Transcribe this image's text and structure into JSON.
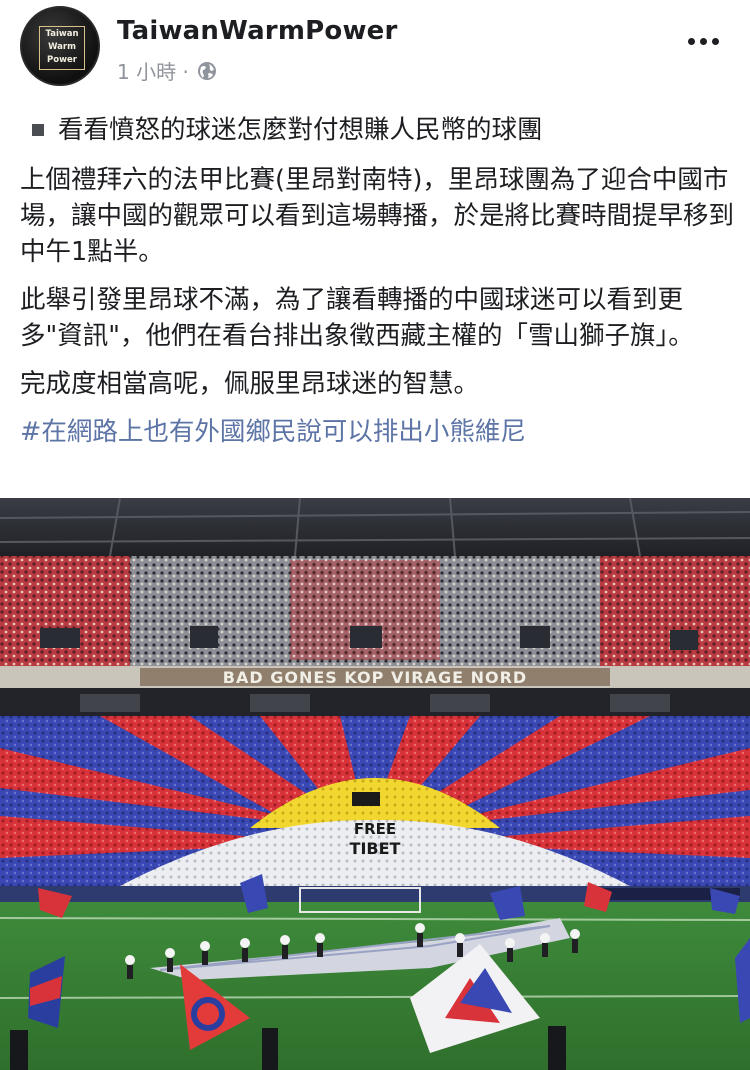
{
  "post": {
    "author": "TaiwanWarmPower",
    "avatar_text": [
      "Taiwan",
      "Warm",
      "Power"
    ],
    "time": "1 小時 ·",
    "audience_icon": "globe-icon",
    "menu_icon": "more-horizontal-icon",
    "headline": "看看憤怒的球迷怎麼對付想賺人民幣的球團",
    "paragraphs": [
      "上個禮拜六的法甲比賽(里昂對南特)，里昂球團為了迎合中國市場，讓中國的觀眾可以看到這場轉播，於是將比賽時間提早移到中午1點半。",
      "此舉引發里昂球不滿，為了讓看轉播的中國球迷可以看到更多\"資訊\"，他們在看台排出象徵西藏主權的「雪山獅子旗」。",
      "完成度相當高呢，佩服里昂球迷的智慧。"
    ],
    "hashtag": "#在網路上也有外國鄉民說可以排出小熊維尼"
  },
  "photo": {
    "stand_banner": "BAD GONES KOP VIRAGE NORD",
    "tifo_text": [
      "FREE",
      "TIBET"
    ]
  },
  "colors": {
    "text": "#1c1e21",
    "meta": "#90949c",
    "link": "#5d74a6",
    "tifo_red": "#d8323a",
    "tifo_blue": "#3a48b4",
    "tifo_yellow": "#f2d730",
    "pitch": "#3f8a3a"
  }
}
